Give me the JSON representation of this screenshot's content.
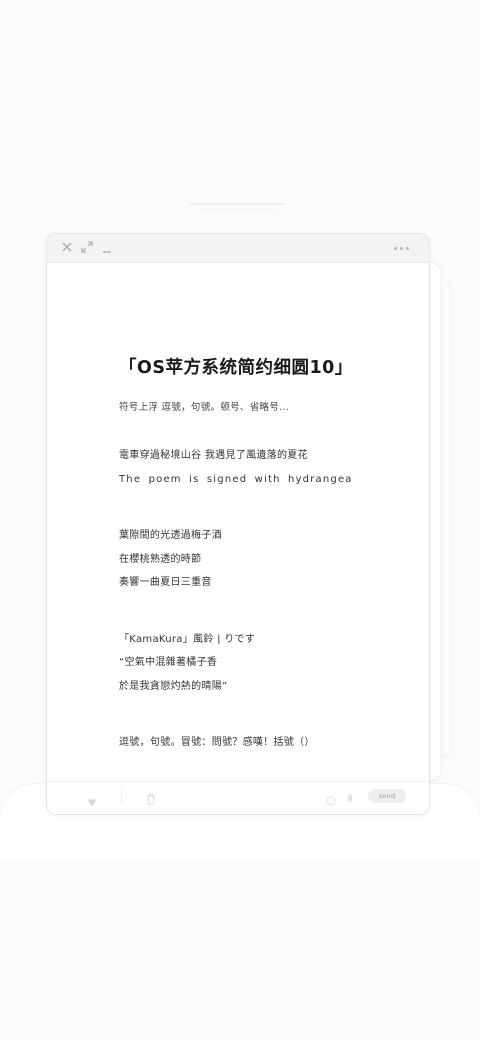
{
  "window": {
    "title_icons": [
      "close-icon",
      "expand-icon",
      "minimize-icon",
      "more-icon"
    ]
  },
  "document": {
    "title": "「OS苹方系统简约细圆10」",
    "subtitle": "符号上浮  逗號，句號。顿号、省略号…",
    "paragraphs": [
      [
        "電車穿過秘境山谷  我遇見了風遺落的夏花",
        "The poem is signed with hydrangea"
      ],
      [
        "葉隙間的光透過梅子酒",
        "在櫻桃熟透的時節",
        "奏響一曲夏日三重音"
      ],
      [
        "「KamaKura」風鈴 | りです",
        "“空氣中混雜著橘子香",
        "於是我貪戀灼熱的晴陽”"
      ],
      [
        "逗號，句號。冒號：問號？感嘆！括號（）"
      ]
    ]
  },
  "bottombar": {
    "icons": [
      "chevron-down-icon",
      "trash-icon",
      "sticker-icon",
      "mic-icon"
    ],
    "send_label": "send"
  }
}
